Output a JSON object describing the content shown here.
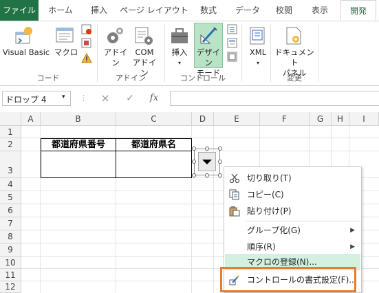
{
  "tabs": [
    "ファイル",
    "ホーム",
    "挿入",
    "ページ レイアウト",
    "数式",
    "データ",
    "校閲",
    "表示",
    "開発"
  ],
  "ribbon": {
    "code_group": {
      "label": "コード",
      "visual_basic": "Visual Basic",
      "macro": "マクロ"
    },
    "addin_group": {
      "label": "アドイン",
      "addin": "アドイン",
      "com_addin_1": "COM",
      "com_addin_2": "アドイン"
    },
    "control_group": {
      "label": "コントロール",
      "insert": "挿入",
      "design_mode_1": "デザイン",
      "design_mode_2": "モード"
    },
    "xml_group": {
      "xml": "XML"
    },
    "modify_group": {
      "label": "変更",
      "doc_panel_1": "ドキュメント",
      "doc_panel_2": "パネル"
    }
  },
  "formula_bar": {
    "name_box": "ドロップ 4",
    "cancel": "×",
    "enter": "✓",
    "fx": "fx",
    "value": ""
  },
  "grid": {
    "columns": [
      "A",
      "B",
      "C",
      "D",
      "E",
      "F",
      "G",
      "H",
      "I"
    ],
    "rows": [
      "1",
      "2",
      "3",
      "4",
      "5",
      "6",
      "7",
      "8",
      "9",
      "10",
      "11",
      "12"
    ],
    "cells": {
      "B2": "都道府県番号",
      "C2": "都道府県名"
    }
  },
  "context_menu": {
    "items": [
      {
        "label": "切り取り(T)",
        "icon": "scissors-icon"
      },
      {
        "label": "コピー(C)",
        "icon": "copy-icon"
      },
      {
        "label": "貼り付け(P)",
        "icon": "paste-icon"
      },
      {
        "label": "グループ化(G)",
        "submenu": true
      },
      {
        "label": "順序(R)",
        "submenu": true
      },
      {
        "label": "マクロの登録(N)..."
      },
      {
        "label": "コントロールの書式設定(F)...",
        "icon": "format-control-icon"
      }
    ]
  },
  "colors": {
    "excel_green": "#217346",
    "highlight_orange": "#e97c2a",
    "menu_hover": "#d3f0e0"
  }
}
